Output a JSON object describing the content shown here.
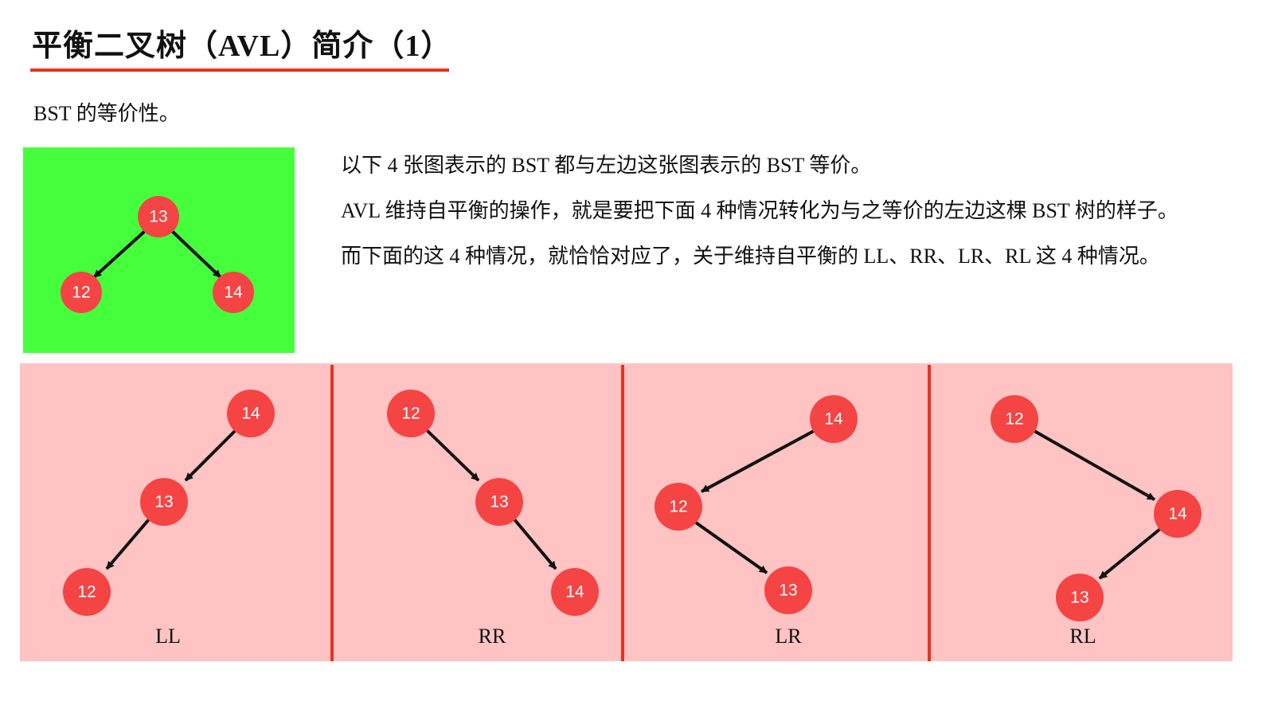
{
  "title": "平衡二叉树（AVL）简介（1）",
  "subtitle": "BST 的等价性。",
  "description": [
    "以下 4 张图表示的 BST 都与左边这张图表示的 BST 等价。",
    "AVL 维持自平衡的操作，就是要把下面 4 种情况转化为与之等价的左边这棵 BST 树的样子。",
    "而下面的这 4 种情况，就恰恰对应了，关于维持自平衡的 LL、RR、LR、RL 这 4 种情况。"
  ],
  "colors": {
    "accent": "#e8321f",
    "balanced_background": "#46ff3c",
    "cases_background": "#ffc3c3",
    "node": "#f54444"
  },
  "balanced_tree": {
    "root": "13",
    "left": "12",
    "right": "14"
  },
  "cases": [
    {
      "label": "LL",
      "nodes": [
        "14",
        "13",
        "12"
      ]
    },
    {
      "label": "RR",
      "nodes": [
        "12",
        "13",
        "14"
      ]
    },
    {
      "label": "LR",
      "nodes": [
        "14",
        "12",
        "13"
      ]
    },
    {
      "label": "RL",
      "nodes": [
        "12",
        "14",
        "13"
      ]
    }
  ]
}
